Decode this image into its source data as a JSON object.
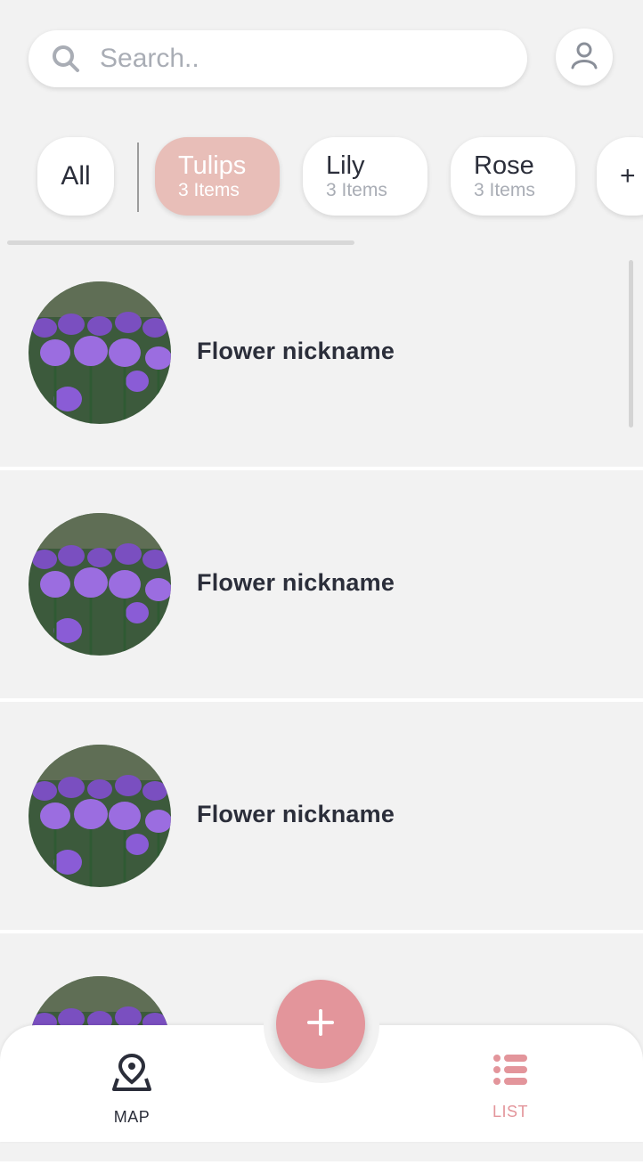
{
  "search": {
    "placeholder": "Search.."
  },
  "categories": {
    "all": {
      "label": "All"
    },
    "items": [
      {
        "name": "Tulips",
        "count": "3 Items",
        "active": true
      },
      {
        "name": "Lily",
        "count": "3 Items",
        "active": false
      },
      {
        "name": "Rose",
        "count": "3 Items",
        "active": false
      }
    ],
    "add_label": "+"
  },
  "list": {
    "items": [
      {
        "nickname": "Flower nickname"
      },
      {
        "nickname": "Flower nickname"
      },
      {
        "nickname": "Flower nickname"
      },
      {
        "nickname": ""
      }
    ]
  },
  "bottom_nav": {
    "map_label": "MAP",
    "list_label": "LIST",
    "add_icon": "plus-icon",
    "map_icon": "map-pin-icon",
    "list_icon": "list-icon"
  },
  "colors": {
    "accent": "#e3959b",
    "active_chip": "#e8beb8",
    "background": "#f2f2f2",
    "text": "#2b2e3a",
    "muted": "#a9adb5"
  }
}
